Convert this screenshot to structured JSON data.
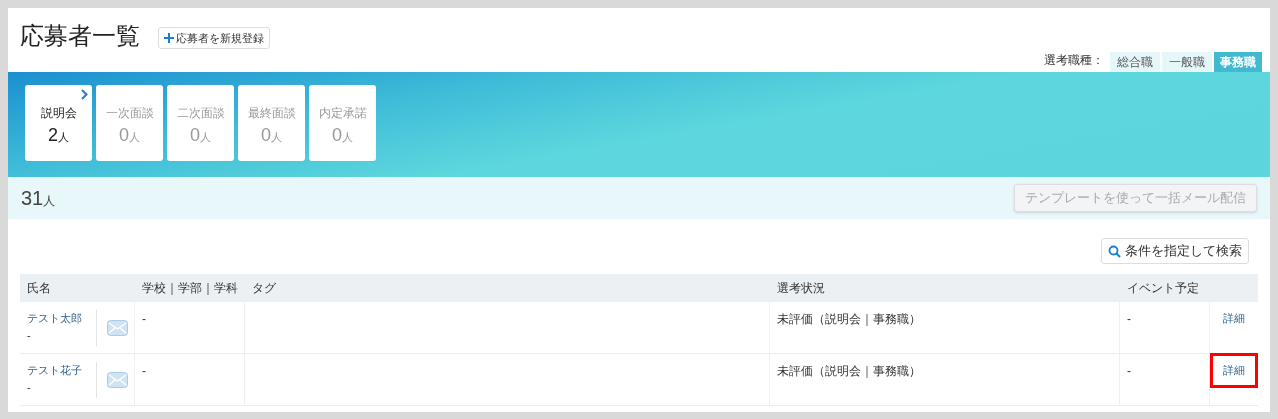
{
  "header": {
    "title": "応募者一覧",
    "add_button": "応募者を新規登録"
  },
  "job_type": {
    "label": "選考職種：",
    "options": [
      {
        "label": "総合職",
        "selected": false
      },
      {
        "label": "一般職",
        "selected": false
      },
      {
        "label": "事務職",
        "selected": true
      }
    ]
  },
  "stages": [
    {
      "name": "説明会",
      "count": "2",
      "unit": "人",
      "selected": true
    },
    {
      "name": "一次面談",
      "count": "0",
      "unit": "人",
      "selected": false
    },
    {
      "name": "二次面談",
      "count": "0",
      "unit": "人",
      "selected": false
    },
    {
      "name": "最終面談",
      "count": "0",
      "unit": "人",
      "selected": false
    },
    {
      "name": "内定承諾",
      "count": "0",
      "unit": "人",
      "selected": false
    }
  ],
  "summary": {
    "count": "31",
    "unit": "人",
    "mail_button": "テンプレートを使って一括メール配信",
    "mail_button_disabled": true
  },
  "search_button": "条件を指定して検索",
  "table": {
    "columns": [
      "氏名",
      "学校｜学部｜学科",
      "タグ",
      "選考状況",
      "イベント予定"
    ],
    "rows": [
      {
        "name": "テスト太郎",
        "sub": "-",
        "school": "-",
        "status": "未評価（説明会｜事務職）",
        "event": "-",
        "detail": "詳細",
        "highlighted": false
      },
      {
        "name": "テスト花子",
        "sub": "-",
        "school": "-",
        "status": "未評価（説明会｜事務職）",
        "event": "-",
        "detail": "詳細",
        "highlighted": true
      }
    ]
  }
}
